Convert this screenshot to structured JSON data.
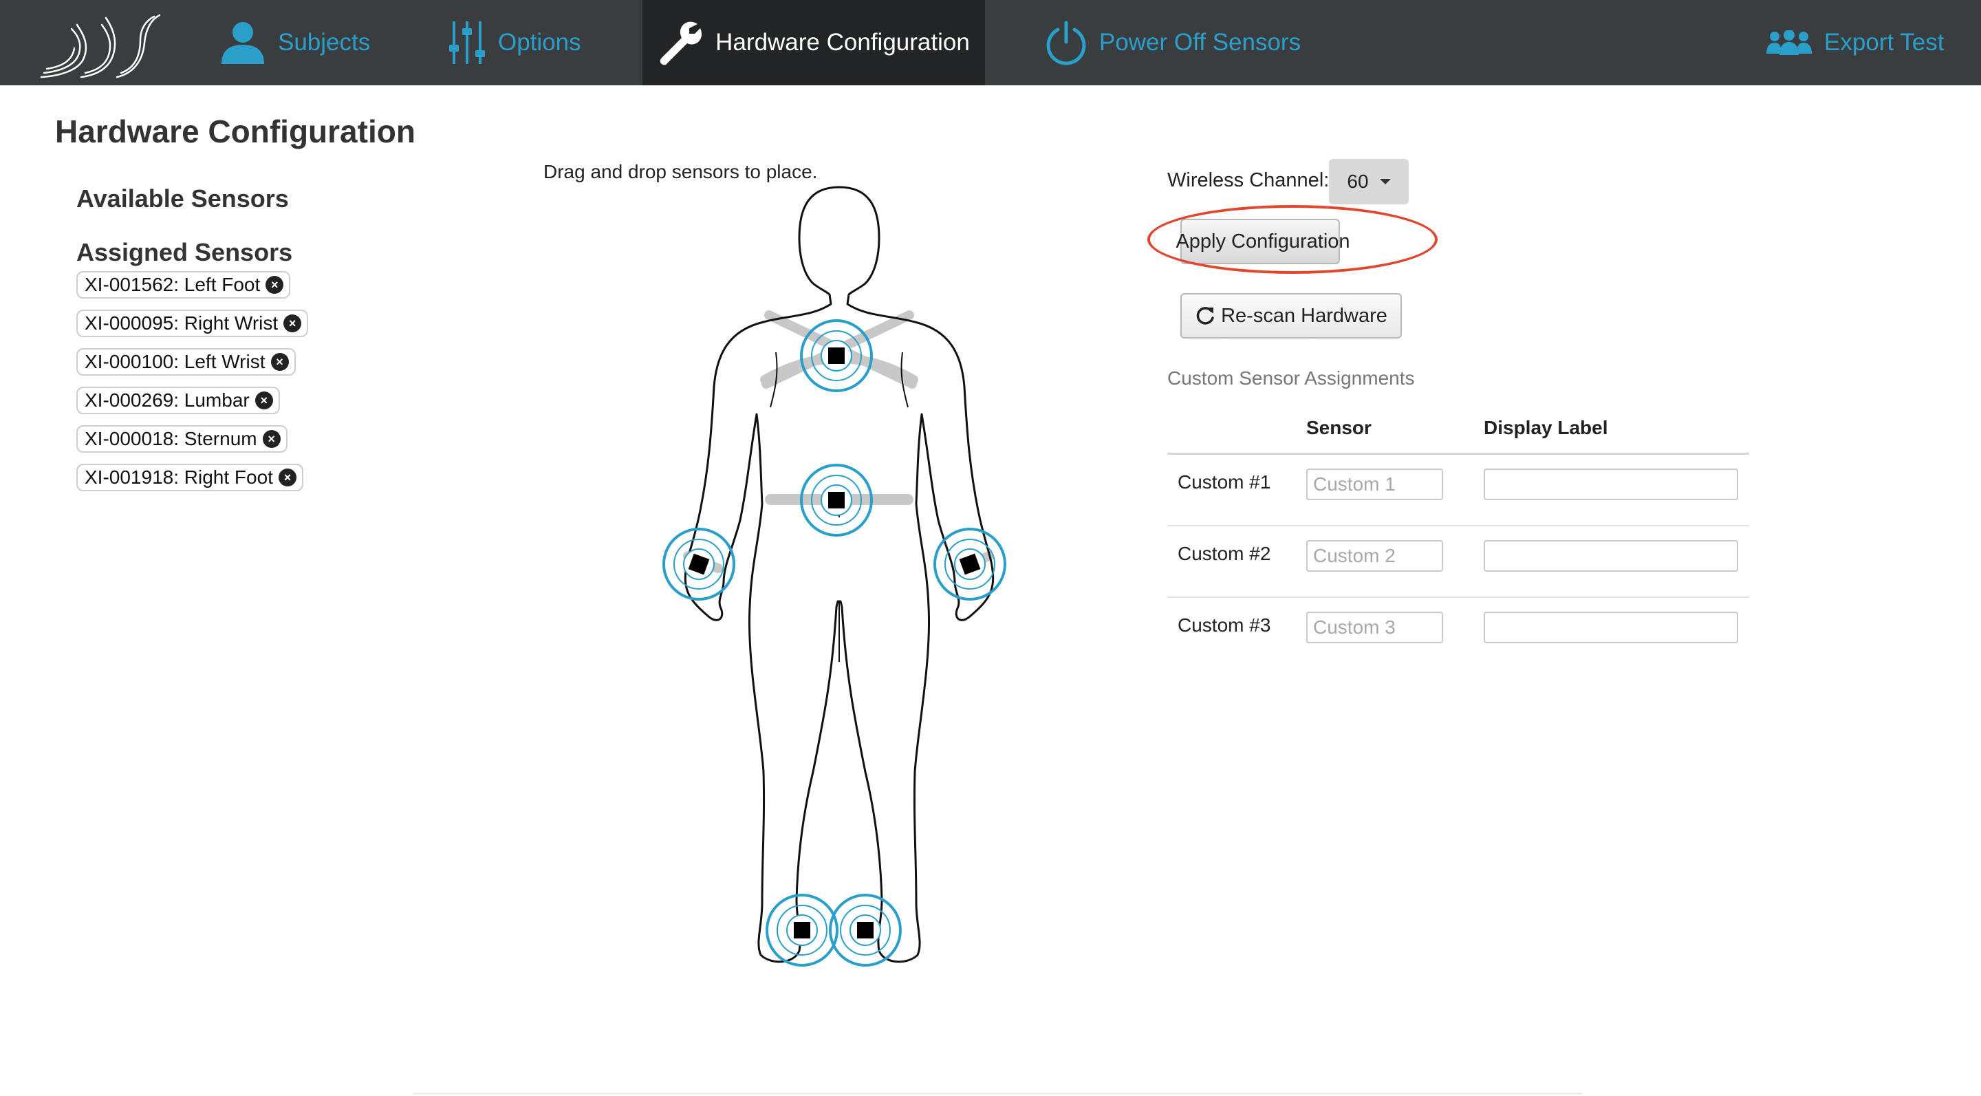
{
  "nav": {
    "subjects": "Subjects",
    "options": "Options",
    "hardware_configuration": "Hardware Configuration",
    "power_off": "Power Off Sensors",
    "export_test": "Export Test",
    "accent_color": "#2a9fc9",
    "active_background": "#222426"
  },
  "page": {
    "title": "Hardware Configuration",
    "available_sensors": "Available Sensors",
    "assigned_sensors": "Assigned Sensors",
    "instructions": "Drag and drop sensors to place."
  },
  "assigned": [
    "XI-001562: Left Foot",
    "XI-000095: Right Wrist",
    "XI-000100: Left Wrist",
    "XI-000269: Lumbar",
    "XI-000018: Sternum",
    "XI-001918: Right Foot"
  ],
  "controls": {
    "wireless_channel_label": "Wireless Channel:",
    "wireless_channel_value": "60",
    "apply_configuration": "Apply Configuration",
    "rescan_hardware": "Re-scan Hardware",
    "highlight_color": "#e0472f"
  },
  "custom": {
    "heading": "Custom Sensor Assignments",
    "col_sensor": "Sensor",
    "col_display": "Display Label",
    "rows": [
      {
        "label": "Custom #1",
        "placeholder": "Custom 1",
        "display_value": ""
      },
      {
        "label": "Custom #2",
        "placeholder": "Custom 2",
        "display_value": ""
      },
      {
        "label": "Custom #3",
        "placeholder": "Custom 3",
        "display_value": ""
      }
    ]
  }
}
